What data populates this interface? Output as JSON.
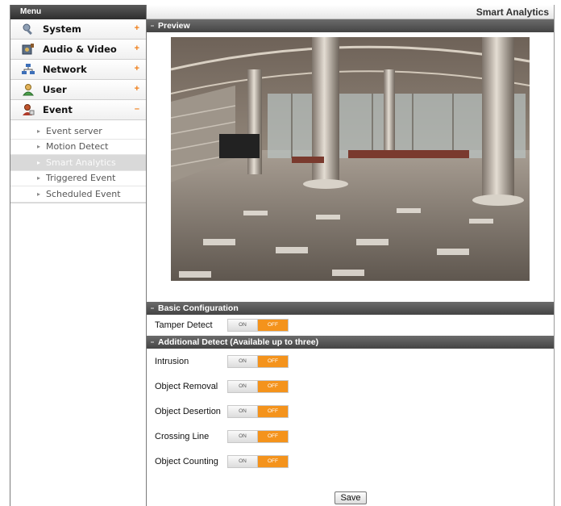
{
  "sidebar": {
    "header": "Menu",
    "items": [
      {
        "label": "System",
        "icon": "wrench-icon",
        "toggle": "+"
      },
      {
        "label": "Audio & Video",
        "icon": "video-icon",
        "toggle": "+"
      },
      {
        "label": "Network",
        "icon": "network-icon",
        "toggle": "+"
      },
      {
        "label": "User",
        "icon": "user-icon",
        "toggle": "+"
      },
      {
        "label": "Event",
        "icon": "event-icon",
        "toggle": "–"
      }
    ],
    "event_submenu": [
      {
        "label": "Event server"
      },
      {
        "label": "Motion Detect"
      },
      {
        "label": "Smart Analytics",
        "active": true
      },
      {
        "label": "Triggered Event"
      },
      {
        "label": "Scheduled Event"
      }
    ]
  },
  "main": {
    "page_title": "Smart Analytics",
    "preview_title": "Preview",
    "basic_title": "Basic Configuration",
    "additional_title": "Additional Detect (Available up to three)",
    "basic_settings": [
      {
        "label": "Tamper Detect",
        "on": "ON",
        "off": "OFF",
        "value": "OFF"
      }
    ],
    "additional_settings": [
      {
        "label": "Intrusion",
        "on": "ON",
        "off": "OFF",
        "value": "OFF"
      },
      {
        "label": "Object Removal",
        "on": "ON",
        "off": "OFF",
        "value": "OFF"
      },
      {
        "label": "Object Desertion",
        "on": "ON",
        "off": "OFF",
        "value": "OFF"
      },
      {
        "label": "Crossing Line",
        "on": "ON",
        "off": "OFF",
        "value": "OFF"
      },
      {
        "label": "Object Counting",
        "on": "ON",
        "off": "OFF",
        "value": "OFF"
      }
    ],
    "save_label": "Save"
  },
  "colors": {
    "accent": "#f4931c",
    "header_dark": "#444444",
    "toggle_off_active": "#f4931c"
  }
}
